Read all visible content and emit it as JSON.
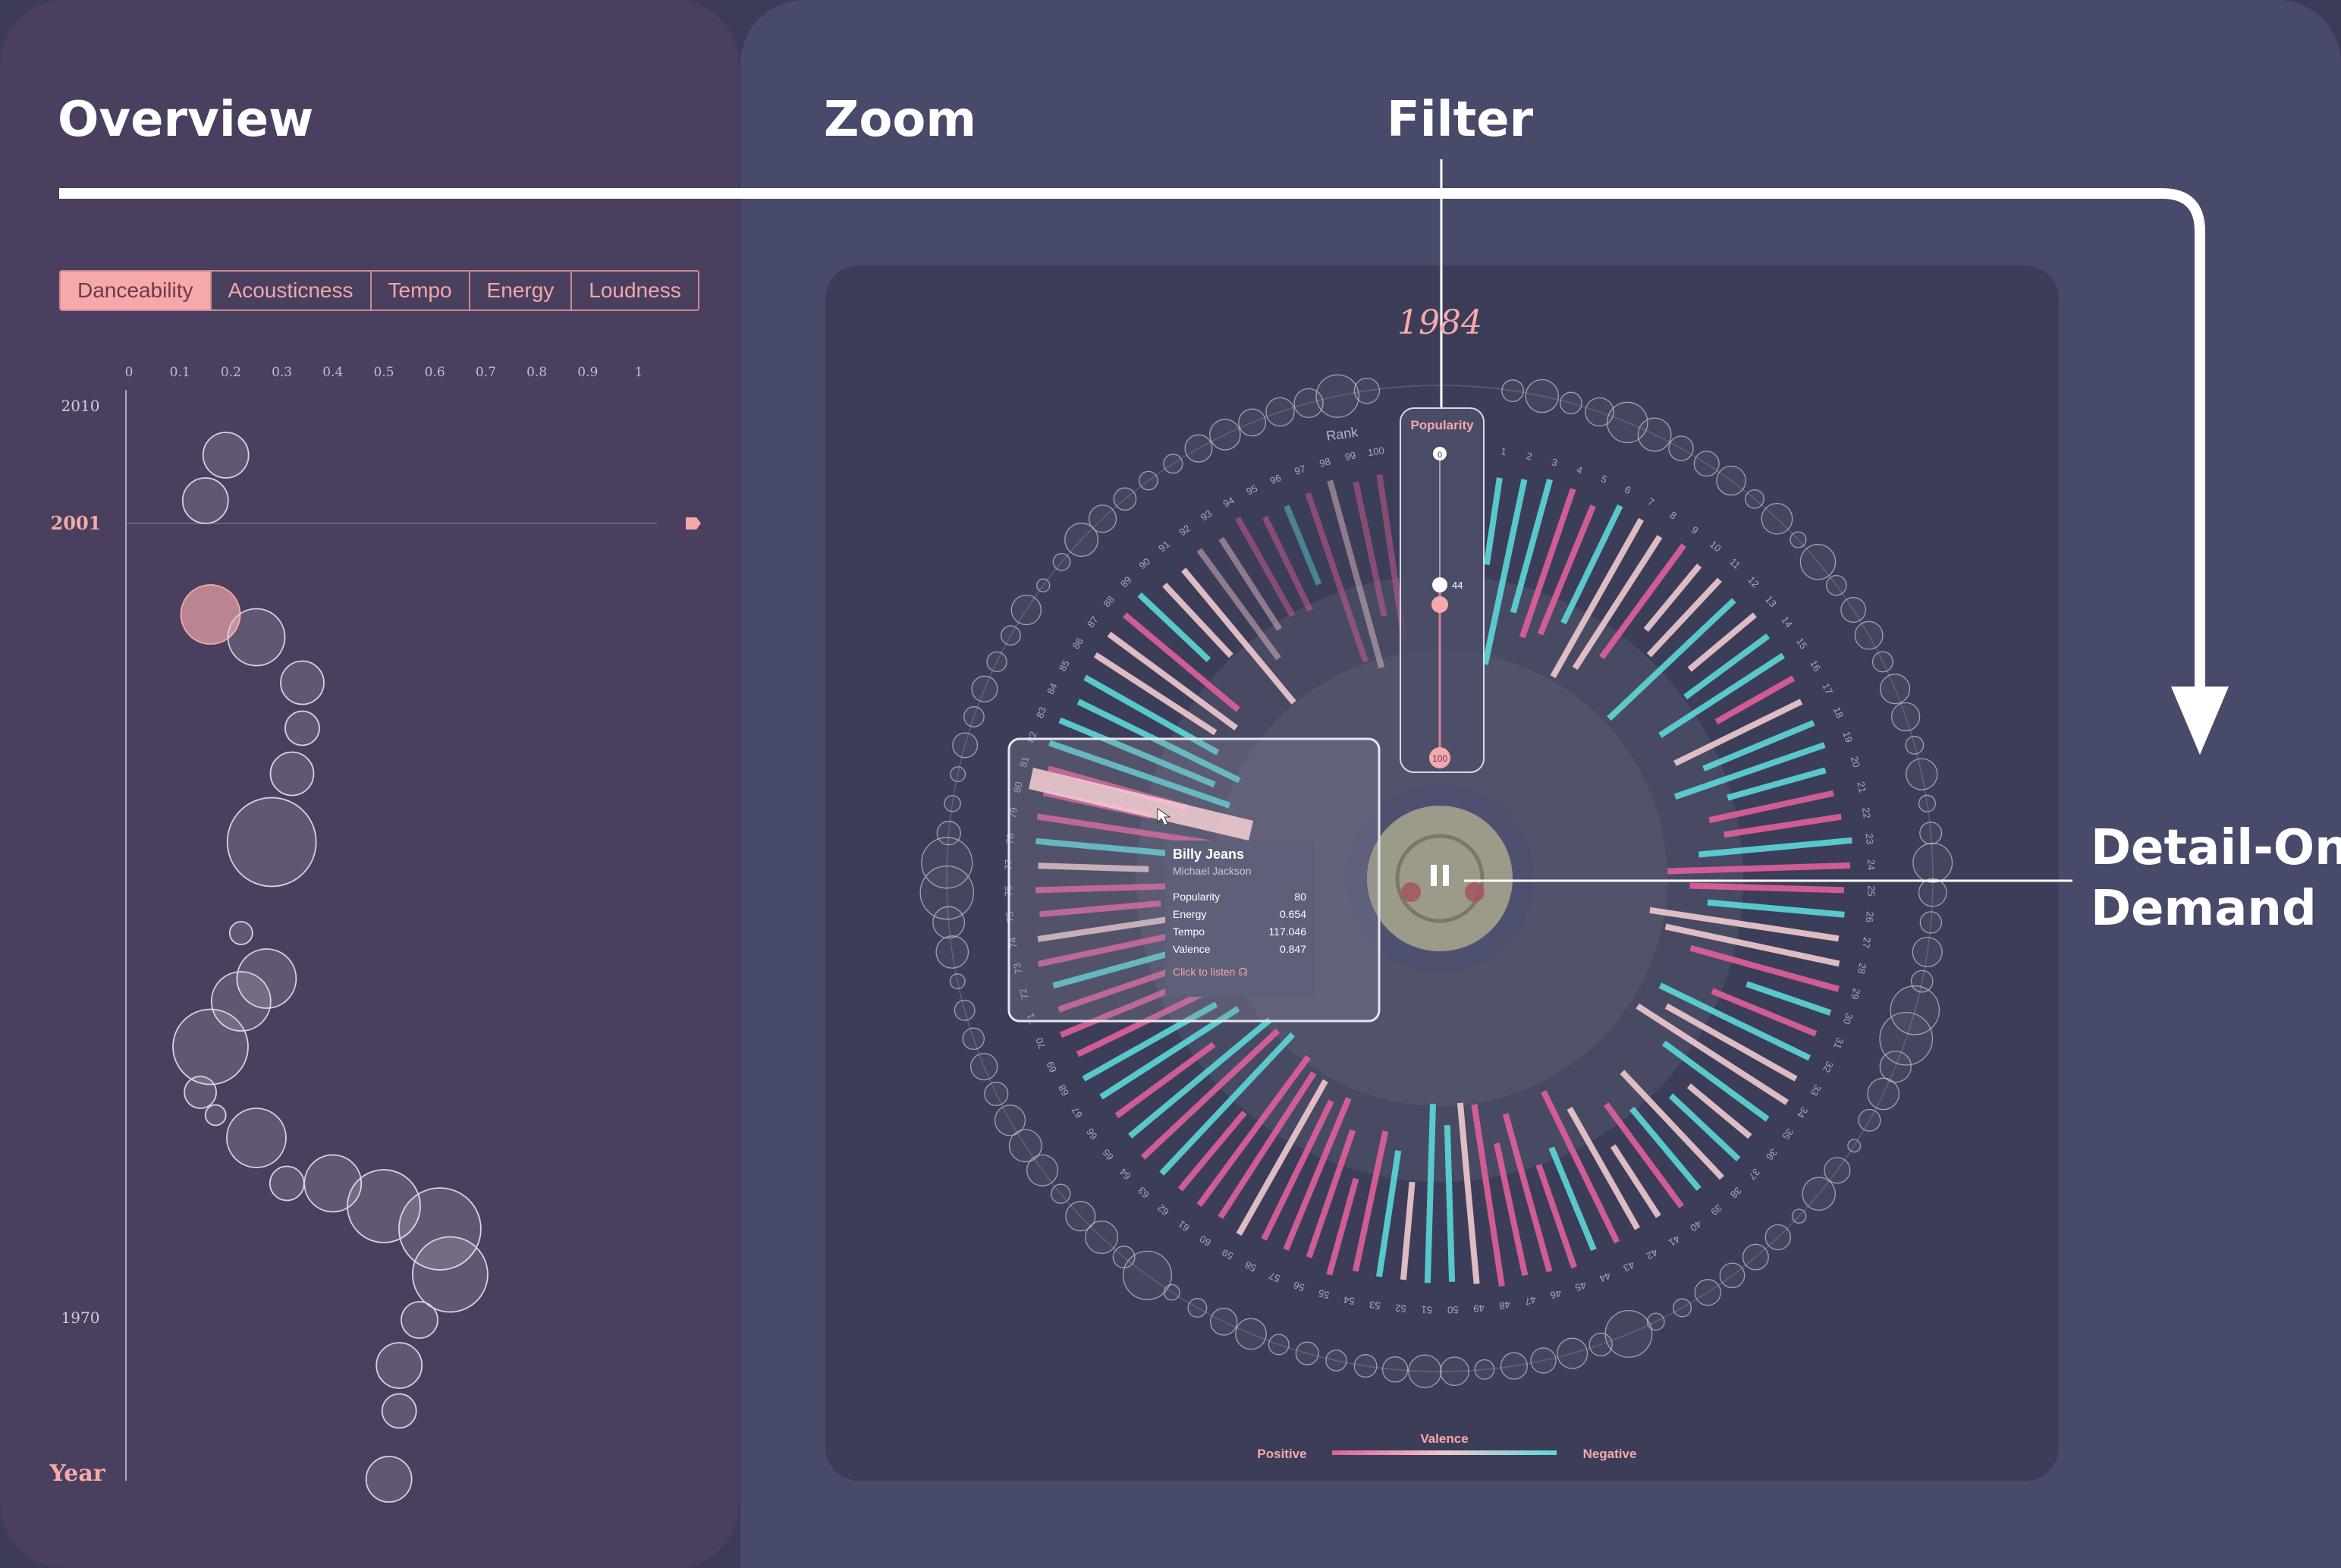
{
  "headings": {
    "overview": "Overview",
    "zoom": "Zoom",
    "filter": "Filter",
    "detail_line1": "Detail-On-",
    "detail_line2": "Demand"
  },
  "tabs": [
    {
      "label": "Danceability",
      "active": true
    },
    {
      "label": "Acousticness",
      "active": false
    },
    {
      "label": "Tempo",
      "active": false
    },
    {
      "label": "Energy",
      "active": false
    },
    {
      "label": "Loudness",
      "active": false
    }
  ],
  "overview": {
    "x_ticks": [
      "0",
      "0.1",
      "0.2",
      "0.3",
      "0.4",
      "0.5",
      "0.6",
      "0.7",
      "0.8",
      "0.9",
      "1"
    ],
    "y_labels": {
      "top": "2010",
      "selected": "2001",
      "bottom": "1970"
    },
    "axis_label": "Year"
  },
  "chart_data": {
    "type": "scatter",
    "title": "",
    "xlabel": "",
    "ylabel": "Year",
    "xlim": [
      0,
      1
    ],
    "ylim": [
      1970,
      2010
    ],
    "note": "bubble size encodes count",
    "points": [
      {
        "year": 2008,
        "x": 0.19,
        "r": 1.0
      },
      {
        "year": 2006,
        "x": 0.15,
        "r": 1.0
      },
      {
        "year": 2001,
        "x": 0.16,
        "r": 1.3,
        "selected": true
      },
      {
        "year": 2000,
        "x": 0.25,
        "r": 1.25
      },
      {
        "year": 1998,
        "x": 0.34,
        "r": 0.95
      },
      {
        "year": 1996,
        "x": 0.34,
        "r": 0.75
      },
      {
        "year": 1994,
        "x": 0.32,
        "r": 0.95
      },
      {
        "year": 1991,
        "x": 0.28,
        "r": 1.95
      },
      {
        "year": 1987,
        "x": 0.22,
        "r": 0.5
      },
      {
        "year": 1985,
        "x": 0.27,
        "r": 1.3
      },
      {
        "year": 1984,
        "x": 0.22,
        "r": 1.3
      },
      {
        "year": 1982,
        "x": 0.16,
        "r": 1.65
      },
      {
        "year": 1980,
        "x": 0.14,
        "r": 0.7
      },
      {
        "year": 1979,
        "x": 0.17,
        "r": 0.45
      },
      {
        "year": 1978,
        "x": 0.25,
        "r": 1.3
      },
      {
        "year": 1976,
        "x": 0.31,
        "r": 0.75
      },
      {
        "year": 1976,
        "x": 0.4,
        "r": 1.25
      },
      {
        "year": 1975,
        "x": 0.5,
        "r": 1.6
      },
      {
        "year": 1974,
        "x": 0.61,
        "r": 1.8
      },
      {
        "year": 1972,
        "x": 0.63,
        "r": 1.65
      },
      {
        "year": 1970,
        "x": 0.57,
        "r": 0.8
      },
      {
        "year": 1968,
        "x": 0.53,
        "r": 1.0
      },
      {
        "year": 1966,
        "x": 0.53,
        "r": 0.75
      },
      {
        "year": 1963,
        "x": 0.51,
        "r": 1.0
      }
    ]
  },
  "radial": {
    "year": "1984",
    "rank_label": "Rank",
    "rank_count": 100,
    "popularity": {
      "label": "Popularity",
      "min": "0",
      "marker": "44",
      "max": "100"
    },
    "cursor_rank": 20
  },
  "tooltip": {
    "title": "Billy Jeans",
    "artist": "Michael Jackson",
    "rows": [
      {
        "label": "Popularity",
        "value": "80"
      },
      {
        "label": "Energy",
        "value": "0.654"
      },
      {
        "label": "Tempo",
        "value": "117.046"
      },
      {
        "label": "Valence",
        "value": "0.847"
      }
    ],
    "link": "Click to listen ☊"
  },
  "legend": {
    "title": "Valence",
    "left": "Positive",
    "right": "Negative"
  },
  "colors": {
    "pink": "#e0609a",
    "cyan": "#5cd8d8",
    "light_pink": "#f1c9cf",
    "accent": "#f6a9ab"
  }
}
